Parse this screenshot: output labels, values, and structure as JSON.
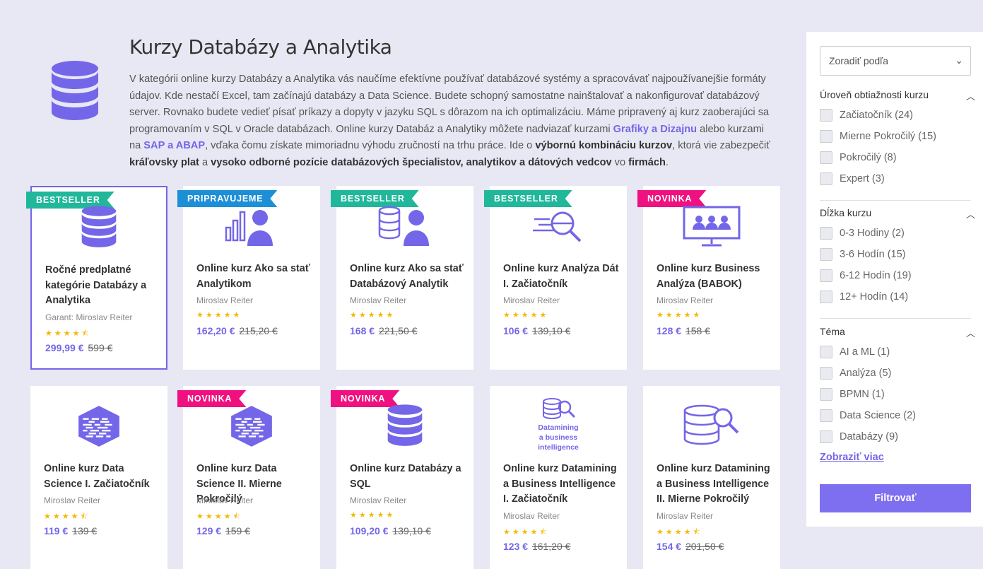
{
  "header": {
    "title": "Kurzy Databázy a Analytika",
    "desc_1": "V kategórii online kurzy Databázy a Analytika vás naučíme efektívne používať databázové systémy a spracovávať najpoužívanejšie formáty údajov. Kde nestačí Excel, tam začínajú databázy a Data Science. Budete schopný samostatne nainštalovať a nakonfigurovať databázový server. Rovnako budete vedieť písať príkazy a dopyty v jazyku SQL s dôrazom na ich optimalizáciu. Máme pripravený aj kurz zaoberajúci sa programovaním v SQL v Oracle databázach. Online kurzy Databáz a Analytiky môžete nadviazať kurzami ",
    "link_1": "Grafiky a Dizajnu",
    "desc_2": " alebo kurzami na ",
    "link_2": "SAP a ABAP",
    "desc_3": ", vďaka čomu získate mimoriadnu výhodu zručností na trhu práce. Ide o ",
    "bold_1": "výbornú kombináciu kurzov",
    "desc_4": ", ktorá vie zabezpečiť ",
    "bold_2": "kráľovsky plat",
    "desc_5": " a ",
    "bold_3": "vysoko odborné pozície databázových špecialistov, analytikov a dátových vedcov",
    "desc_6": " vo ",
    "bold_4": "firmách",
    "desc_7": "."
  },
  "cards": [
    {
      "ribbon": "BESTSELLER",
      "title": "Ročné predplatné kategórie Databázy a Analytika",
      "author": "Garant: Miroslav Reiter",
      "rating": 4.5,
      "stars": "★★★★⯪",
      "price": "299,99 €",
      "old_price": "599 €",
      "icon": "database-icon"
    },
    {
      "ribbon": "PRIPRAVUJEME",
      "title": "Online kurz Ako sa stať Analytikom",
      "author": "Miroslav Reiter",
      "rating": 5,
      "stars": "★★★★★",
      "price": "162,20 €",
      "old_price": "215,20 €",
      "icon": "analyst-icon"
    },
    {
      "ribbon": "BESTSELLER",
      "title": "Online kurz Ako sa stať Databázový Analytik",
      "author": "Miroslav Reiter",
      "rating": 5,
      "stars": "★★★★★",
      "price": "168 €",
      "old_price": "221,50 €",
      "icon": "database-person-icon"
    },
    {
      "ribbon": "BESTSELLER",
      "title": "Online kurz Analýza Dát I. Začiatočník",
      "author": "Miroslav Reiter",
      "rating": 5,
      "stars": "★★★★★",
      "price": "106 €",
      "old_price": "139,10 €",
      "icon": "magnifier-icon"
    },
    {
      "ribbon": "NOVINKA",
      "title": "Online kurz Business Analýza (BABOK)",
      "author": "Miroslav Reiter",
      "rating": 5,
      "stars": "★★★★★",
      "price": "128 €",
      "old_price": "158 €",
      "icon": "presentation-icon"
    },
    {
      "ribbon": "",
      "title": "Online kurz Data Science I. Začiatočník",
      "author": "Miroslav Reiter",
      "rating": 4.5,
      "stars": "★★★★⯪",
      "price": "119 €",
      "old_price": "139 €",
      "icon": "cube-icon"
    },
    {
      "ribbon": "NOVINKA",
      "title": "Online kurz Data Science II. Mierne Pokročilý",
      "author": "Miroslav Reiter",
      "rating": 4.5,
      "stars": "★★★★⯪",
      "price": "129 €",
      "old_price": "159 €",
      "icon": "cube-icon"
    },
    {
      "ribbon": "NOVINKA",
      "title": "Online kurz Databázy a SQL",
      "author": "Miroslav Reiter",
      "rating": 5,
      "stars": "★★★★★",
      "price": "109,20 €",
      "old_price": "139,10 €",
      "icon": "database-icon"
    },
    {
      "ribbon": "",
      "title": "Online kurz Datamining a Business Intelligence I. Začiatočník",
      "author": "Miroslav Reiter",
      "rating": 4.5,
      "stars": "★★★★⯪",
      "price": "123 €",
      "old_price": "161,20 €",
      "icon": "datamining-icon",
      "icon_text": [
        "Datamining",
        "a business",
        "intelligence"
      ]
    },
    {
      "ribbon": "",
      "title": "Online kurz Datamining a Business Intelligence II. Mierne Pokročilý",
      "author": "Miroslav Reiter",
      "rating": 4.5,
      "stars": "★★★★⯪",
      "price": "154 €",
      "old_price": "201,50 €",
      "icon": "database-search-icon"
    }
  ],
  "sidebar": {
    "sort_label": "Zoradiť podľa",
    "groups": [
      {
        "title": "Úroveň obtiažnosti kurzu",
        "options": [
          "Začiatočník (24)",
          "Mierne Pokročilý (15)",
          "Pokročilý (8)",
          "Expert (3)"
        ]
      },
      {
        "title": "Dĺžka kurzu",
        "options": [
          "0-3 Hodiny (2)",
          "3-6 Hodín (15)",
          "6-12 Hodín (19)",
          "12+ Hodín (14)"
        ]
      },
      {
        "title": "Téma",
        "options": [
          "AI a ML (1)",
          "Analýza (5)",
          "BPMN (1)",
          "Data Science (2)",
          "Databázy (9)"
        ]
      }
    ],
    "more_label": "Zobraziť viac",
    "filter_button": "Filtrovať"
  },
  "colors": {
    "accent": "#7466e8",
    "bestseller": "#20b79a",
    "preparing": "#1d8fd6",
    "new": "#ef117f",
    "star": "#f5b800"
  }
}
